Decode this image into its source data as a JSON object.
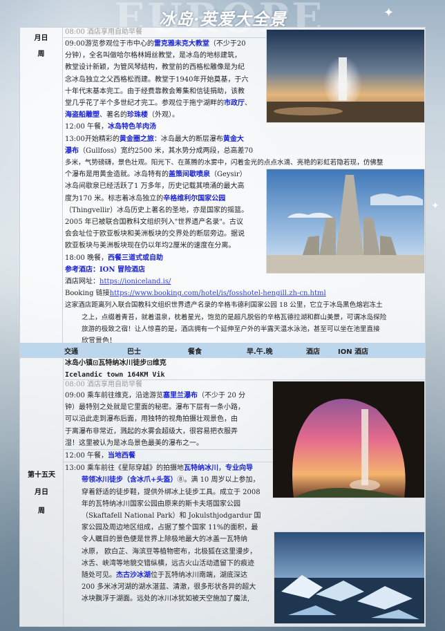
{
  "header": {
    "bg_word": "EUROPE",
    "title": "冰岛·英爱大全景"
  },
  "day1": {
    "label": [
      "月日",
      "周"
    ],
    "breakfast": "08:00 酒店享用自助早餐",
    "lines": [
      "09:00游览参观位于市中心的",
      "雷克雅未克大教堂",
      "（不少于20",
      "分钟），全名叫做哈尔格林姆丝教堂，是冰岛的地标建筑，",
      "教堂设计新颖，为管风琴结构，教堂前的西格松雕像是为纪",
      "念冰岛独立之父西格松而建。教堂于1940年开始奠基，于六",
      "十年代末基本完工。由于经费靠教会筹集和信徒捐助，该教",
      "堂几乎花了半个多世纪才完工。参观位于拖宁湖畔的",
      "市政厅",
      "、",
      "海盗船雕塑",
      "、著名的",
      "珍珠楼",
      "（外观）。",
      "12:00 午餐，",
      "冰岛特色羊肉汤",
      "13:00开始精彩的",
      "黄金圈之旅",
      "：冰岛最大的断层瀑布",
      "黄金大",
      "瀑布",
      "（Gullfoss）宽约2500 米，其水势分成两段，总高差70",
      "多米，气势磅礴，景色壮观。阳光下、在蒸腾的水雾中，闪着金光的点点水滴、亮艳的彩虹若隐若现，仿佛整",
      "个瀑布是用黄金造就。冰岛特有的",
      "盖策间歇喷泉",
      "（Geysir）",
      "冰岛间歇泉已经活跃了1 万多年，历史记载其喷涌的最大高",
      "度为170 米。标志着冰岛独立的",
      "辛格维利尔国家公园",
      "（Thingvellir）冰岛历史上著名的圣地，亦是国家的摇篮。",
      "2005 年已被联合国教科文组织列入\"世界遗产名录\"。古议",
      "会会址位于欧亚板块和美洲板块的交界处的断层旁边。据说",
      "欧亚板块与美洲板块现在仍以年均2厘米的速度在分离。",
      "18:00 晚餐，",
      "西餐三道式或自助",
      "参考酒店：ION 冒险酒店",
      "酒店网址：",
      "https://ioniceland.is/",
      "Booking 链接",
      "https://www.booking.com/hotel/is/fosshotel-hengill.zh-cn.html",
      "这家酒店距离列入联合国教科文组织世界遗产名录的辛格韦德利国家公园 18 公里，它立于冰岛黑色熔岩冻土",
      "之上，点缀着青苔，就着温泉，枕着星光，饱览的是超凡脱俗的辛格瓦德拉湖和群山美景，可谓冰岛探险",
      "旅游的极致之宿！让人惊喜的是，酒店拥有一个延伸至户外的半露天温水泳池，甚至可以坐在池里直接",
      "欣赏景色！"
    ]
  },
  "transport": {
    "c1": "交通",
    "c2": "巴士",
    "c3": "餐食",
    "c4": "早.午.晚",
    "c5": "酒店",
    "c6": "ION 酒店"
  },
  "day2": {
    "label": [
      "第十五天",
      "月日",
      "周"
    ],
    "route": "冰岛小镇⊡瓦特纳冰川徒步⊡维克",
    "route_en": "Icelandic town 164KM  Vik",
    "breakfast": "08:00 酒店享用自助早餐",
    "lines": [
      "09:00 乘车前往维克，沿途游览",
      "塞里兰瀑布",
      "（不少于 20 分",
      "钟）最特别之处就是它里面的秘密。瀑布下层有一条小路，",
      "可以沿此走到瀑布后面，用独特的视角拍摄壮观景色，由",
      "于离瀑布非常近，溅起的水雾会超级大，很容易把衣服弄",
      "湿！这里被认为是冰岛景色最美的瀑布之一。",
      "12:00 午餐，",
      "当地西餐",
      "13:00 乘车前往《星际穿越》的拍摄地",
      "瓦特纳冰川",
      "，",
      "专业向导",
      "带领冰川徒步（含冰爪+头盔）",
      "⑧。满 10 周岁以上参加，",
      "穿着舒适的徒步鞋，提供外绑冰上徒步工具。成立于 2008",
      "年的瓦特纳冰川国家公园由原来的斯卡夫塔国家公园",
      "（Skaftafell National Park）和 Jokulsthjodgardur 国",
      "家公园及周边地区组成，占据了整个国家 11%的面积，最",
      "令人瞩目的景色便是世界上除极地最大的冰盖一瓦特纳",
      "冰原，  欧白芷、海滨豆等植物密布，北极狐在这里漫步，",
      "冰舌、峡湾等地貌交错纵横，远古火山活动遗留下的痕迹",
      "随处可见。",
      "杰古沙冰湖",
      "位于瓦特纳冰川南端，湖底深达",
      "200 多米冰河湖的湖水湛蓝、清澈，很多形状各异的超大",
      "冰块飘浮于湖面。远处的冰川冰犹如被天空施加了魔法,"
    ]
  },
  "icons": [
    "sparkle-icon"
  ]
}
